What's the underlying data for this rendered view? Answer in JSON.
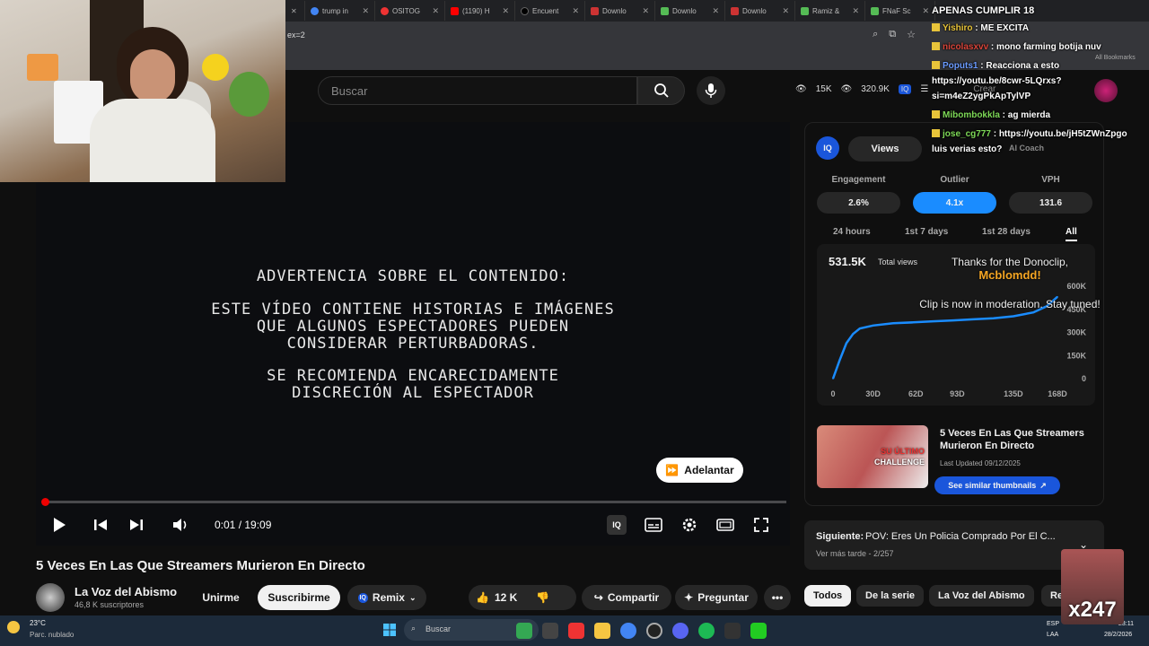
{
  "browser": {
    "tabs": [
      "trump in",
      "OSITOG",
      "(1190) H",
      "Encuent",
      "Downlo",
      "Downlo",
      "Downlo",
      "Ramiz &",
      "FNaF Sc"
    ],
    "url_fragment": "ex=2",
    "bookmarks_label": "All Bookmarks"
  },
  "header": {
    "search_placeholder": "Buscar",
    "stats_subs": "15K",
    "stats_views": "320.9K",
    "create_label": "Crear"
  },
  "video": {
    "warning_title": "ADVERTENCIA SOBRE EL CONTENIDO:",
    "warning_line1": "ESTE VÍDEO CONTIENE HISTORIAS E IMÁGENES",
    "warning_line2": "QUE ALGUNOS ESPECTADORES PUEDEN",
    "warning_line3": "CONSIDERAR PERTURBADORAS.",
    "warning_line4": "SE RECOMIENDA ENCARECIDAMENTE",
    "warning_line5": "DISCRECIÓN AL ESPECTADOR",
    "skip_label": "Adelantar",
    "time": "0:01 / 19:09",
    "progress": 0.001,
    "title": "5 Veces En Las Que Streamers Murieron En Directo"
  },
  "channel": {
    "name": "La Voz del Abismo",
    "subs": "46,8 K suscriptores",
    "join": "Unirme",
    "subscribe": "Suscribirme",
    "remix": "Remix"
  },
  "actions": {
    "likes": "12 K",
    "share": "Compartir",
    "ask": "Preguntar"
  },
  "iq": {
    "views_tab": "Views",
    "coach_tab": "AI Coach",
    "metrics": [
      {
        "label": "Engagement",
        "value": "2.6%"
      },
      {
        "label": "Outlier",
        "value": "4.1x"
      },
      {
        "label": "VPH",
        "value": "131.6"
      }
    ],
    "ranges": [
      "24 hours",
      "1st 7 days",
      "1st 28 days",
      "All"
    ],
    "total": "531.5K",
    "total_label": "Total views",
    "accent": "#1a8cff"
  },
  "chart_data": {
    "type": "line",
    "x": [
      0,
      5,
      10,
      15,
      20,
      30,
      45,
      60,
      75,
      90,
      105,
      120,
      135,
      150,
      160,
      168
    ],
    "values": [
      0,
      120000,
      230000,
      290000,
      325000,
      345000,
      360000,
      365000,
      372000,
      378000,
      385000,
      392000,
      405000,
      430000,
      470000,
      531500
    ],
    "xticks": [
      "0",
      "30D",
      "62D",
      "93D",
      "135D",
      "168D"
    ],
    "yticks": [
      "0",
      "150K",
      "300K",
      "450K",
      "600K"
    ],
    "ylim": [
      0,
      600000
    ]
  },
  "related": {
    "title": "5 Veces En Las Que Streamers Murieron En Directo",
    "thumb_text_1": "SU ÚLTIMO",
    "thumb_text_2": "CHALLENGE",
    "updated": "Last Updated 09/12/2025",
    "similar": "See similar thumbnails"
  },
  "next": {
    "label": "Siguiente:",
    "title": "POV: Eres Un Policia Comprado Por El C...",
    "sub": "Ver más tarde - 2/257"
  },
  "chips": [
    "Todos",
    "De la serie",
    "La Voz del Abismo",
    "Re"
  ],
  "chat": {
    "header": "APENAS CUMPLIR 18",
    "messages": [
      {
        "user": "Yishiro",
        "text": "ME EXCITA",
        "color": "#e8c43a"
      },
      {
        "user": "nicolasxvv",
        "text": "mono farming botija nuv",
        "color": "#d9453a"
      },
      {
        "user": "Poputs1",
        "text": "Reacciona a esto",
        "color": "#6b9bff"
      },
      {
        "user": "",
        "text": "https://youtu.be/8cwr-5LQrxs?",
        "color": "#fff"
      },
      {
        "user": "",
        "text": "si=m4eZ2ygPkApTylVP",
        "color": "#fff"
      },
      {
        "user": "Mibombokkla",
        "text": "ag mierda",
        "color": "#7ed957"
      },
      {
        "user": "jose_cg777",
        "text": "https://youtu.be/jH5tZWnZpgo",
        "color": "#7ed957"
      },
      {
        "user": "",
        "text": "luis verias esto?",
        "color": "#fff"
      }
    ]
  },
  "donation": {
    "line1": "Thanks for the Donoclip,",
    "name": "Mcblomdd!",
    "line2": "Clip is now in moderation. Stay tuned!"
  },
  "taskbar": {
    "temp": "23°C",
    "weather": "Parc. nublado",
    "search": "Buscar",
    "lang": "ESP",
    "lang2": "LAA",
    "time": "23:11",
    "date": "28/2/2026"
  },
  "emote_text": "x247"
}
